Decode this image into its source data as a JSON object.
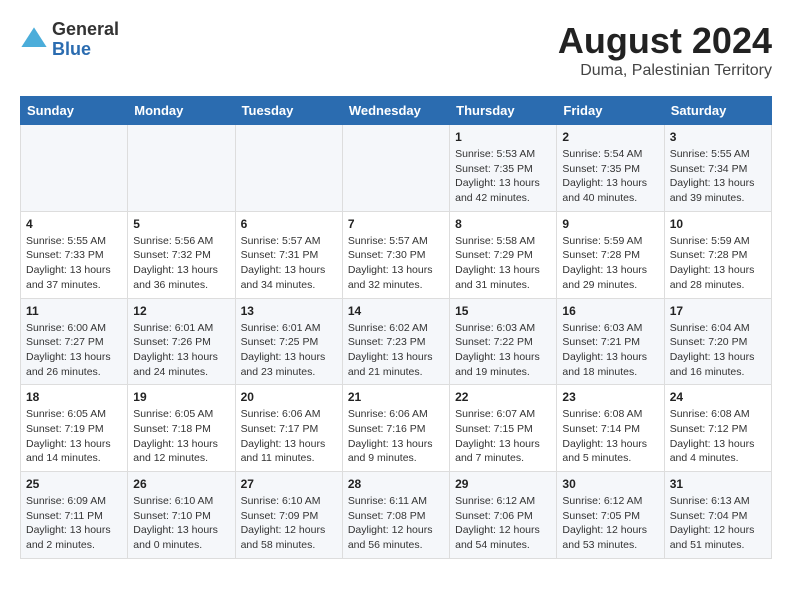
{
  "header": {
    "logo_general": "General",
    "logo_blue": "Blue",
    "main_title": "August 2024",
    "subtitle": "Duma, Palestinian Territory"
  },
  "calendar": {
    "days_of_week": [
      "Sunday",
      "Monday",
      "Tuesday",
      "Wednesday",
      "Thursday",
      "Friday",
      "Saturday"
    ],
    "weeks": [
      [
        {
          "day": "",
          "info": ""
        },
        {
          "day": "",
          "info": ""
        },
        {
          "day": "",
          "info": ""
        },
        {
          "day": "",
          "info": ""
        },
        {
          "day": "1",
          "info": "Sunrise: 5:53 AM\nSunset: 7:35 PM\nDaylight: 13 hours\nand 42 minutes."
        },
        {
          "day": "2",
          "info": "Sunrise: 5:54 AM\nSunset: 7:35 PM\nDaylight: 13 hours\nand 40 minutes."
        },
        {
          "day": "3",
          "info": "Sunrise: 5:55 AM\nSunset: 7:34 PM\nDaylight: 13 hours\nand 39 minutes."
        }
      ],
      [
        {
          "day": "4",
          "info": "Sunrise: 5:55 AM\nSunset: 7:33 PM\nDaylight: 13 hours\nand 37 minutes."
        },
        {
          "day": "5",
          "info": "Sunrise: 5:56 AM\nSunset: 7:32 PM\nDaylight: 13 hours\nand 36 minutes."
        },
        {
          "day": "6",
          "info": "Sunrise: 5:57 AM\nSunset: 7:31 PM\nDaylight: 13 hours\nand 34 minutes."
        },
        {
          "day": "7",
          "info": "Sunrise: 5:57 AM\nSunset: 7:30 PM\nDaylight: 13 hours\nand 32 minutes."
        },
        {
          "day": "8",
          "info": "Sunrise: 5:58 AM\nSunset: 7:29 PM\nDaylight: 13 hours\nand 31 minutes."
        },
        {
          "day": "9",
          "info": "Sunrise: 5:59 AM\nSunset: 7:28 PM\nDaylight: 13 hours\nand 29 minutes."
        },
        {
          "day": "10",
          "info": "Sunrise: 5:59 AM\nSunset: 7:28 PM\nDaylight: 13 hours\nand 28 minutes."
        }
      ],
      [
        {
          "day": "11",
          "info": "Sunrise: 6:00 AM\nSunset: 7:27 PM\nDaylight: 13 hours\nand 26 minutes."
        },
        {
          "day": "12",
          "info": "Sunrise: 6:01 AM\nSunset: 7:26 PM\nDaylight: 13 hours\nand 24 minutes."
        },
        {
          "day": "13",
          "info": "Sunrise: 6:01 AM\nSunset: 7:25 PM\nDaylight: 13 hours\nand 23 minutes."
        },
        {
          "day": "14",
          "info": "Sunrise: 6:02 AM\nSunset: 7:23 PM\nDaylight: 13 hours\nand 21 minutes."
        },
        {
          "day": "15",
          "info": "Sunrise: 6:03 AM\nSunset: 7:22 PM\nDaylight: 13 hours\nand 19 minutes."
        },
        {
          "day": "16",
          "info": "Sunrise: 6:03 AM\nSunset: 7:21 PM\nDaylight: 13 hours\nand 18 minutes."
        },
        {
          "day": "17",
          "info": "Sunrise: 6:04 AM\nSunset: 7:20 PM\nDaylight: 13 hours\nand 16 minutes."
        }
      ],
      [
        {
          "day": "18",
          "info": "Sunrise: 6:05 AM\nSunset: 7:19 PM\nDaylight: 13 hours\nand 14 minutes."
        },
        {
          "day": "19",
          "info": "Sunrise: 6:05 AM\nSunset: 7:18 PM\nDaylight: 13 hours\nand 12 minutes."
        },
        {
          "day": "20",
          "info": "Sunrise: 6:06 AM\nSunset: 7:17 PM\nDaylight: 13 hours\nand 11 minutes."
        },
        {
          "day": "21",
          "info": "Sunrise: 6:06 AM\nSunset: 7:16 PM\nDaylight: 13 hours\nand 9 minutes."
        },
        {
          "day": "22",
          "info": "Sunrise: 6:07 AM\nSunset: 7:15 PM\nDaylight: 13 hours\nand 7 minutes."
        },
        {
          "day": "23",
          "info": "Sunrise: 6:08 AM\nSunset: 7:14 PM\nDaylight: 13 hours\nand 5 minutes."
        },
        {
          "day": "24",
          "info": "Sunrise: 6:08 AM\nSunset: 7:12 PM\nDaylight: 13 hours\nand 4 minutes."
        }
      ],
      [
        {
          "day": "25",
          "info": "Sunrise: 6:09 AM\nSunset: 7:11 PM\nDaylight: 13 hours\nand 2 minutes."
        },
        {
          "day": "26",
          "info": "Sunrise: 6:10 AM\nSunset: 7:10 PM\nDaylight: 13 hours\nand 0 minutes."
        },
        {
          "day": "27",
          "info": "Sunrise: 6:10 AM\nSunset: 7:09 PM\nDaylight: 12 hours\nand 58 minutes."
        },
        {
          "day": "28",
          "info": "Sunrise: 6:11 AM\nSunset: 7:08 PM\nDaylight: 12 hours\nand 56 minutes."
        },
        {
          "day": "29",
          "info": "Sunrise: 6:12 AM\nSunset: 7:06 PM\nDaylight: 12 hours\nand 54 minutes."
        },
        {
          "day": "30",
          "info": "Sunrise: 6:12 AM\nSunset: 7:05 PM\nDaylight: 12 hours\nand 53 minutes."
        },
        {
          "day": "31",
          "info": "Sunrise: 6:13 AM\nSunset: 7:04 PM\nDaylight: 12 hours\nand 51 minutes."
        }
      ]
    ]
  }
}
